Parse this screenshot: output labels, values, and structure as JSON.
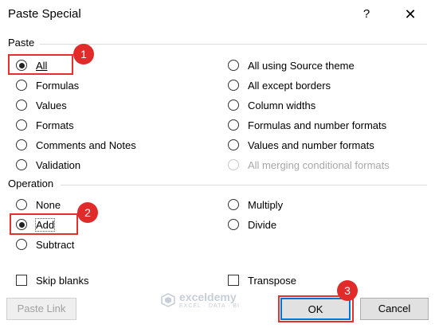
{
  "window": {
    "title": "Paste Special",
    "help": "?",
    "close": "✕"
  },
  "paste": {
    "label": "Paste",
    "left": [
      "All",
      "Formulas",
      "Values",
      "Formats",
      "Comments and Notes",
      "Validation"
    ],
    "right": [
      "All using Source theme",
      "All except borders",
      "Column widths",
      "Formulas and number formats",
      "Values and number formats",
      "All merging conditional formats"
    ],
    "selected": "All"
  },
  "operation": {
    "label": "Operation",
    "left": [
      "None",
      "Add",
      "Subtract"
    ],
    "right": [
      "Multiply",
      "Divide"
    ],
    "selected": "Add"
  },
  "options": {
    "skip_blanks": "Skip blanks",
    "transpose": "Transpose"
  },
  "buttons": {
    "paste_link": "Paste Link",
    "ok": "OK",
    "cancel": "Cancel"
  },
  "annotations": {
    "badge1": "1",
    "badge2": "2",
    "badge3": "3"
  },
  "watermark": {
    "name": "exceldemy",
    "tagline": "EXCEL · DATA · BI"
  },
  "colors": {
    "highlight": "#e5312e",
    "badge": "#e12b2b",
    "focus": "#0078d7"
  }
}
